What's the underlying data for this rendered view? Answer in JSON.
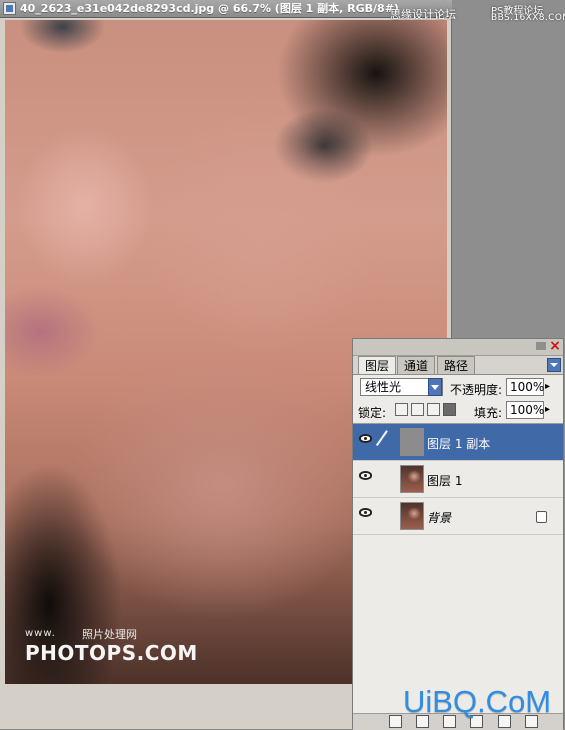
{
  "document": {
    "title": "40_2623_e31e042de8293cd.jpg @ 66.7% (图层 1 副本, RGB/8#)"
  },
  "watermarks": {
    "top_right_left": "思缘设计论坛",
    "top_right_right_top": "PS教程论坛",
    "top_right_right_bottom": "BBS.16XX8.COM",
    "photo_www": "www.",
    "photo_cn": "照片处理网",
    "photo_main": "PHOTOPS.COM",
    "bottom_right": "UiBQ.CoM"
  },
  "layers_panel": {
    "tabs": [
      "图层",
      "通道",
      "路径"
    ],
    "active_tab_index": 0,
    "blend_mode": "线性光",
    "opacity_label": "不透明度:",
    "opacity_value": "100%",
    "lock_label": "锁定:",
    "fill_label": "填充:",
    "fill_value": "100%",
    "layers": [
      {
        "name": "图层 1 副本",
        "selected": true
      },
      {
        "name": "图层 1",
        "selected": false
      },
      {
        "name": "背景",
        "selected": false,
        "locked": true
      }
    ]
  }
}
